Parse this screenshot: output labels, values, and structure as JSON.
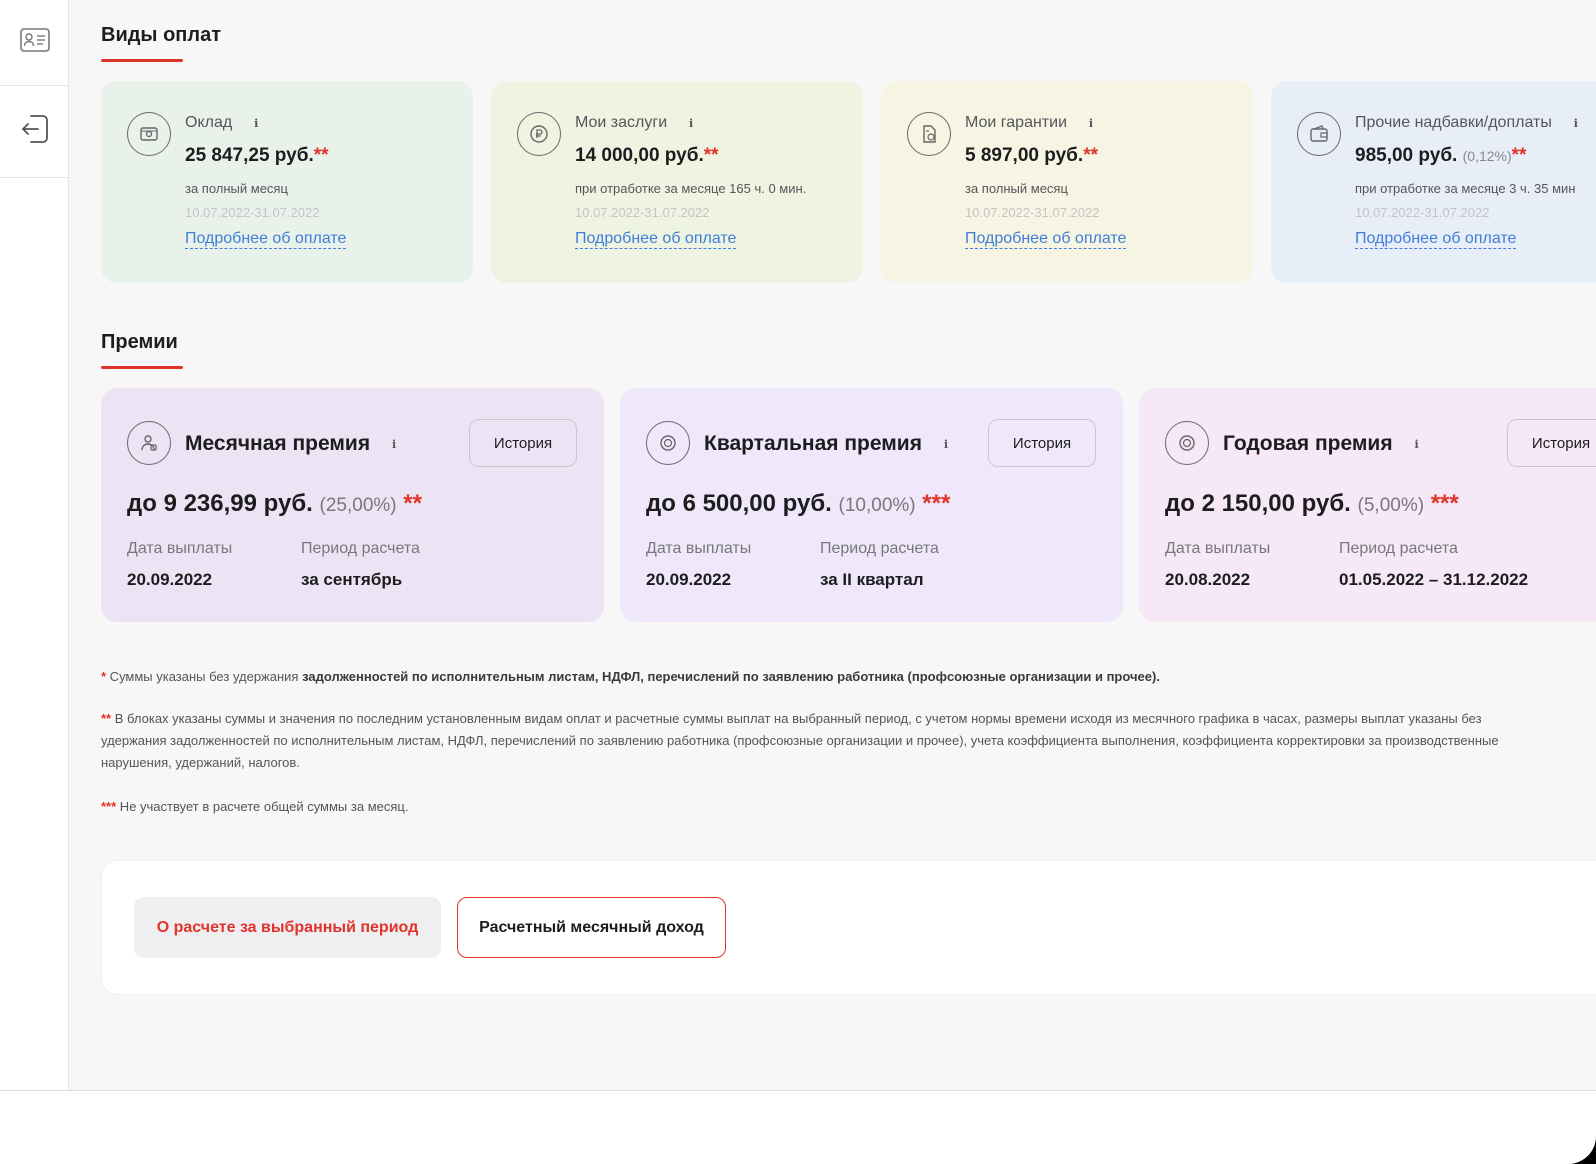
{
  "pay_section": {
    "title": "Виды оплат",
    "cards": [
      {
        "name": "Оклад",
        "amount": "25 847,25 руб.",
        "percent": "",
        "stars": "**",
        "note": "за полный месяц",
        "dates": "10.07.2022-31.07.2022",
        "link": "Подробнее об оплате",
        "bg": "#e9f2ea",
        "icon": "banknotes-icon"
      },
      {
        "name": "Мои заслуги",
        "amount": "14 000,00 руб.",
        "percent": "",
        "stars": "**",
        "note": "при отработке за месяце 165 ч. 0 мин.",
        "dates": "10.07.2022-31.07.2022",
        "link": "Подробнее об оплате",
        "bg": "#eff4e2",
        "icon": "ruble-coin-icon"
      },
      {
        "name": "Мои гарантии",
        "amount": "5 897,00 руб.",
        "percent": "",
        "stars": "**",
        "note": "за полный месяц",
        "dates": "10.07.2022-31.07.2022",
        "link": "Подробнее об оплате",
        "bg": "#f6f4e2",
        "icon": "document-money-icon"
      },
      {
        "name": "Прочие надбавки/доплаты",
        "amount": "985,00 руб.",
        "percent": "(0,12%)",
        "stars": "**",
        "note": "при отработке за месяце 3 ч. 35 мин",
        "dates": "10.07.2022-31.07.2022",
        "link": "Подробнее об оплате",
        "bg": "#e8eef8",
        "icon": "wallet-icon"
      }
    ]
  },
  "bonus_section": {
    "title": "Премии",
    "history_label": "История",
    "date_label": "Дата выплаты",
    "period_label": "Период расчета",
    "cards": [
      {
        "name": "Месячная премия",
        "amount": "до 9 236,99 руб.",
        "percent": "(25,00%)",
        "stars": "**",
        "date": "20.09.2022",
        "period": "за сентябрь",
        "bg": "#ece4f4",
        "icon": "person-badge-icon"
      },
      {
        "name": "Квартальная премия",
        "amount": "до 6 500,00 руб.",
        "percent": "(10,00%)",
        "stars": "***",
        "date": "20.09.2022",
        "period": "за II квартал",
        "bg": "#efe8fa",
        "icon": "medal-icon"
      },
      {
        "name": "Годовая премия",
        "amount": "до 2 150,00 руб.",
        "percent": "(5,00%)",
        "stars": "***",
        "date": "20.08.2022",
        "period": "01.05.2022 – 31.12.2022",
        "bg": "#f6e8f6",
        "icon": "medal-icon"
      }
    ]
  },
  "footnotes": {
    "f1_star": "*",
    "f1_text": " Суммы указаны без удержания ",
    "f1_bold": "задолженностей по исполнительным листам, НДФЛ, перечислений по заявлению работника (профсоюзные организации и прочее).",
    "f2_star": "**",
    "f2_line1": " В блоках указаны суммы и значения по последним установленным видам оплат и расчетные суммы выплат на выбранный период, с учетом нормы времени исходя из месячного графика в часах, размеры выплат указаны без",
    "f2_line2": "удержания задолженностей по исполнительным листам, НДФЛ, перечислений по заявлению работника (профсоюзные организации и прочее), учета коэффициента выполнения, коэффициента корректировки за производственные",
    "f2_line3": "нарушения, удержаний, налогов.",
    "f3_star": "***",
    "f3_text": " Не участвует в расчете общей суммы за месяц."
  },
  "actions": {
    "calc_period": "О расчете за выбранный период",
    "monthly_income": "Расчетный месячный доход"
  },
  "sidebar": {
    "items": [
      {
        "icon": "id-card-icon"
      },
      {
        "icon": "logout-icon"
      }
    ]
  },
  "info_symbol": "i",
  "colors": {
    "accent": "#e0332a",
    "link": "#3f7ed8"
  }
}
